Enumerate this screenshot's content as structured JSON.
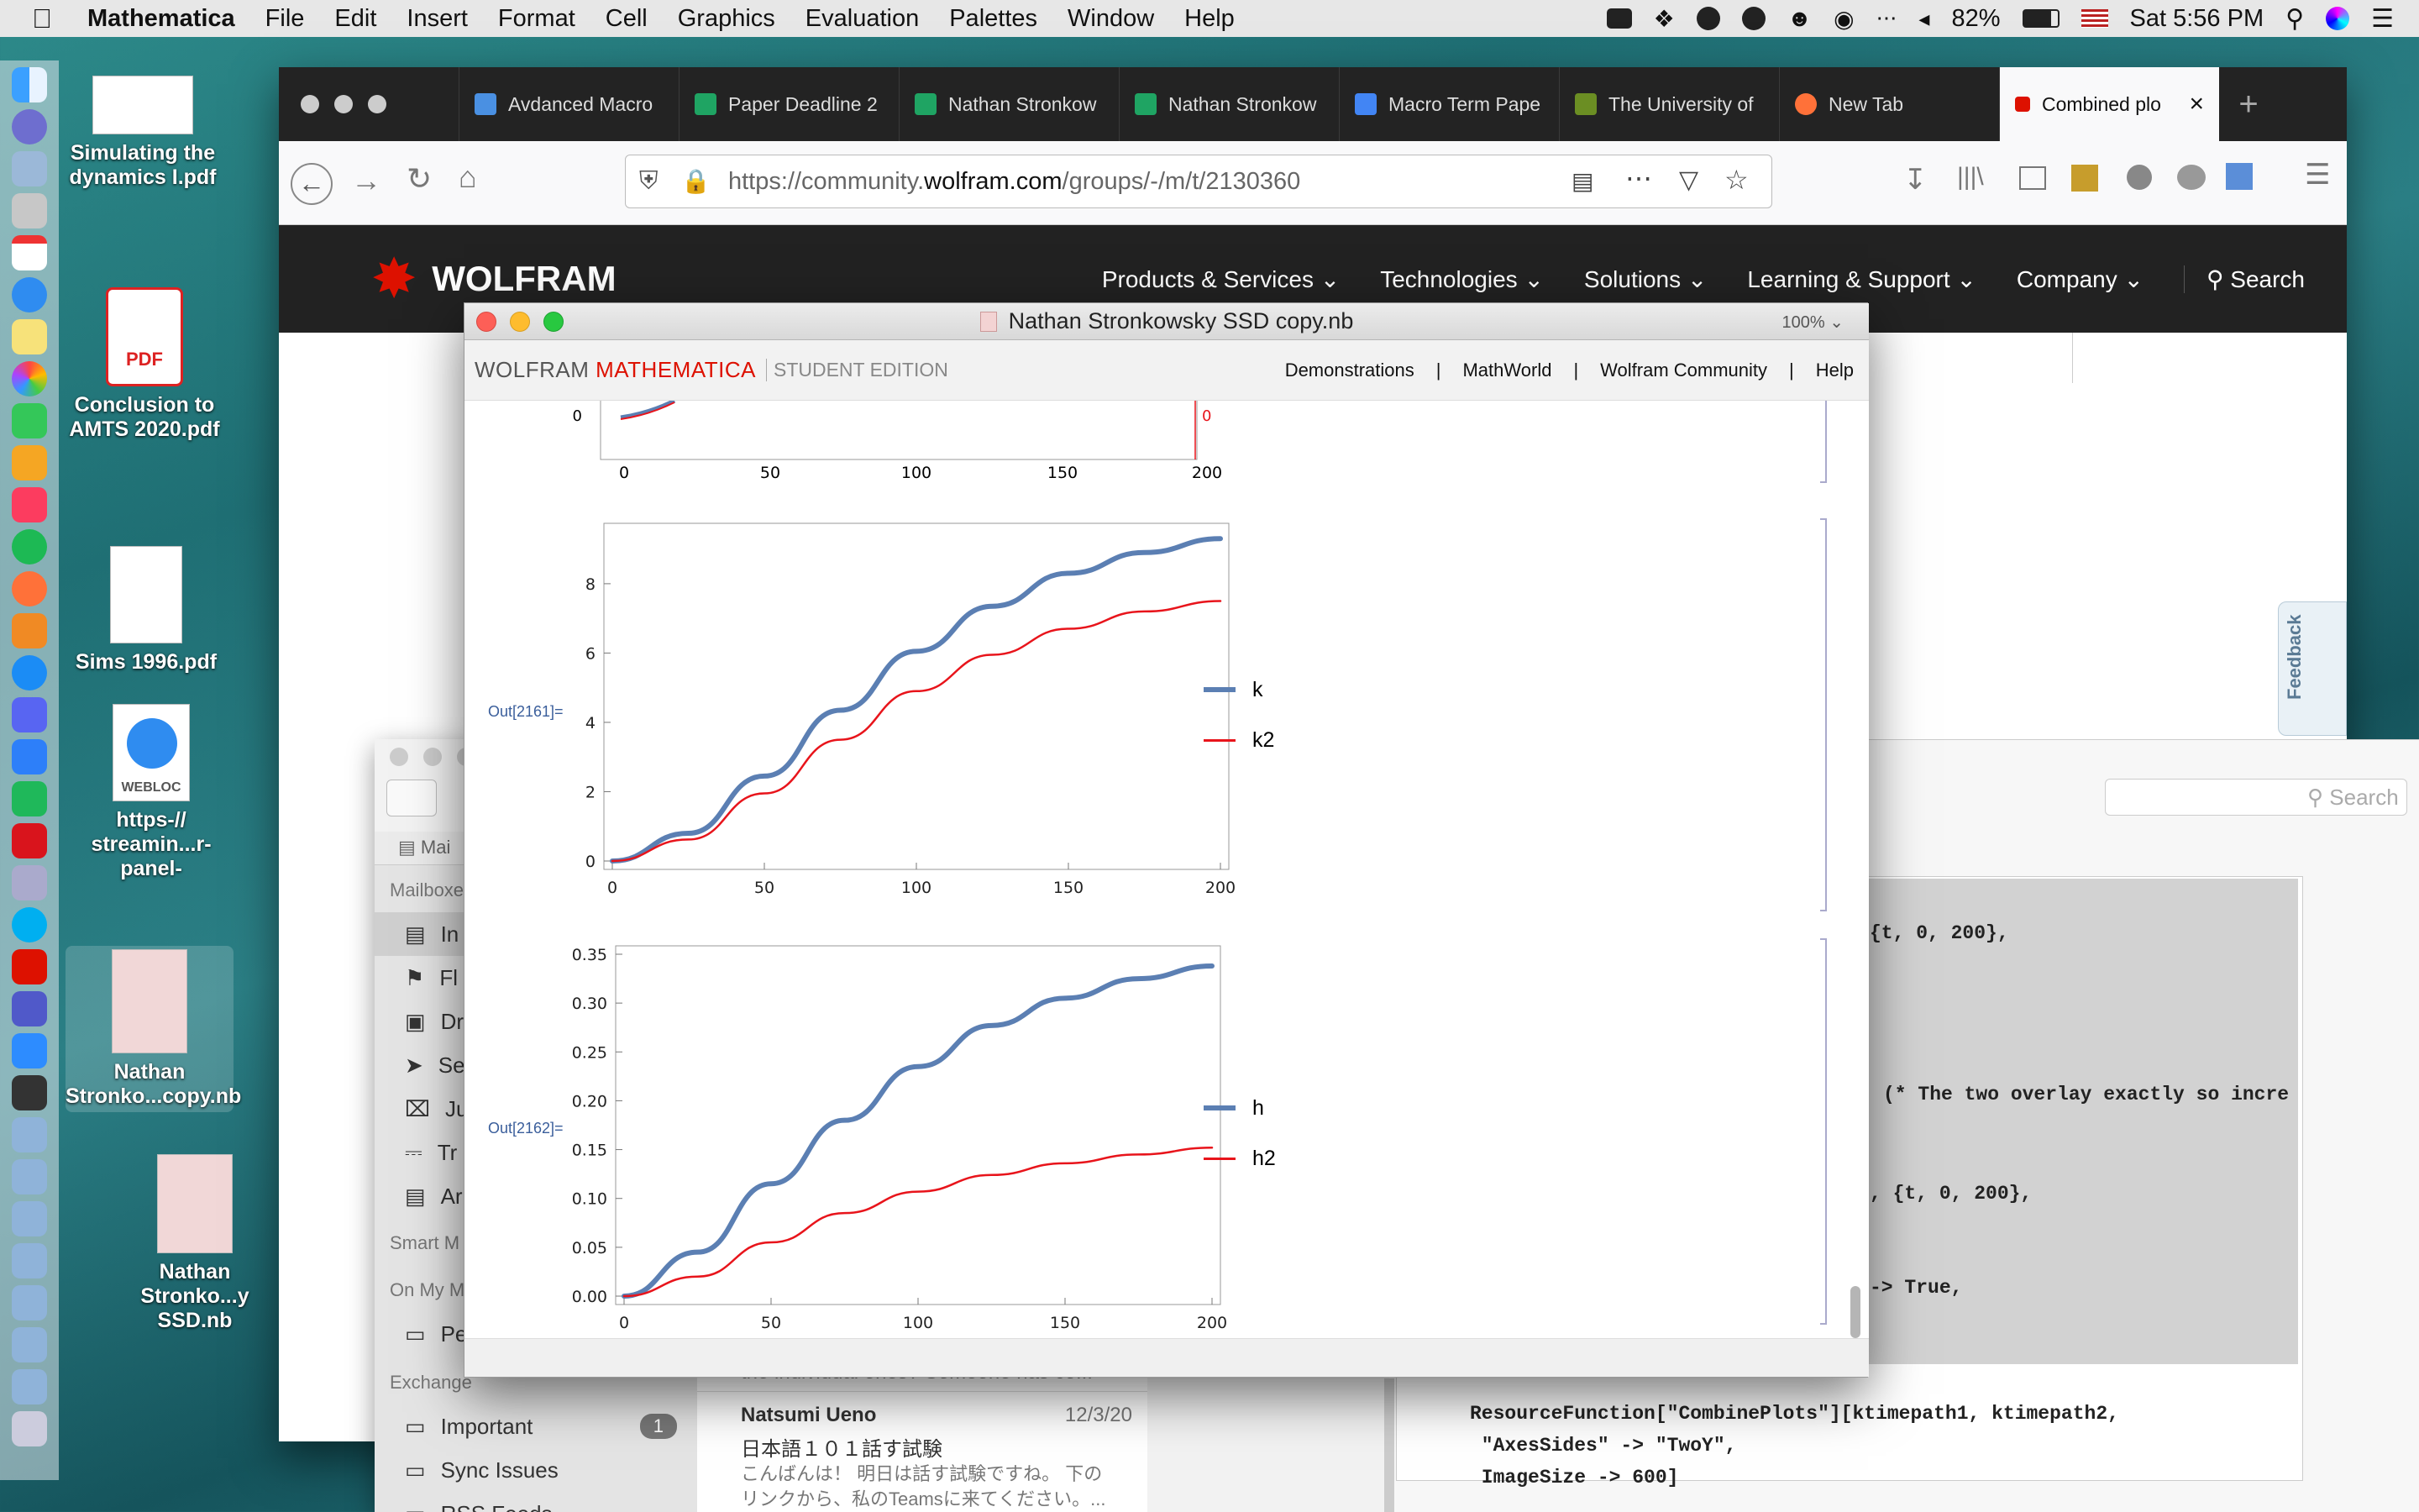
{
  "menubar": {
    "apple": "",
    "app": "Mathematica",
    "items": [
      "File",
      "Edit",
      "Insert",
      "Format",
      "Cell",
      "Graphics",
      "Evaluation",
      "Palettes",
      "Window",
      "Help"
    ],
    "battery": "82%",
    "clock": "Sat 5:56 PM"
  },
  "desktop": [
    {
      "label1": "Simulating the",
      "label2": "dynamics I.pdf"
    },
    {
      "label1": "Conclusion to",
      "label2": "AMTS 2020.pdf",
      "badge": "PDF"
    },
    {
      "label1": "Sims 1996.pdf",
      "label2": ""
    },
    {
      "label1": "https-//",
      "label2": "streamin...r-panel-",
      "badge": "WEBLOC"
    },
    {
      "label1": "Nathan",
      "label2": "Stronko...copy.nb"
    },
    {
      "label1": "Nathan",
      "label2": "Stronko...y SSD.nb"
    }
  ],
  "browser": {
    "tabs": [
      {
        "label": "Avdanced Macro",
        "color": "#4a90e2"
      },
      {
        "label": "Paper Deadline 2",
        "color": "#1fa463"
      },
      {
        "label": "Nathan Stronkow",
        "color": "#1fa463"
      },
      {
        "label": "Nathan Stronkow",
        "color": "#1fa463"
      },
      {
        "label": "Macro Term Pape",
        "color": "#4285f4"
      },
      {
        "label": "The University of",
        "color": "#6b8e23"
      },
      {
        "label": "New Tab",
        "color": "#ff7139"
      },
      {
        "label": "Combined plo",
        "color": "#dd1100"
      }
    ],
    "url_prefix": "https://community.",
    "url_domain": "wolfram.com",
    "url_path": "/groups/-/m/t/2130360",
    "site_logo": "WOLFRAM",
    "nav": [
      "Products & Services",
      "Technologies",
      "Solutions",
      "Learning & Support",
      "Company"
    ],
    "search": "Search",
    "feedback": "Feedback"
  },
  "mathematica": {
    "title": "Nathan Stronkowsky SSD copy.nb",
    "zoom": "100%",
    "brand_a": "WOLFRAM ",
    "brand_b": "MATHEMATICA",
    "brand_c": "STUDENT EDITION",
    "links": [
      "Demonstrations",
      "MathWorld",
      "Wolfram Community",
      "Help"
    ],
    "out1": "Out[2161]=",
    "out2": "Out[2162]="
  },
  "mail": {
    "search": "Search",
    "sidebar": [
      {
        "label": "Mailboxes",
        "type": "header"
      },
      {
        "label": "In",
        "type": "item"
      },
      {
        "label": "Fl",
        "type": "item"
      },
      {
        "label": "Dr",
        "type": "item"
      },
      {
        "label": "Se",
        "type": "item"
      },
      {
        "label": "Ju",
        "type": "item"
      },
      {
        "label": "Tr",
        "type": "item"
      },
      {
        "label": "Ar",
        "type": "item"
      },
      {
        "label": "Smart M",
        "type": "header"
      },
      {
        "label": "On My M",
        "type": "header"
      },
      {
        "label": "Pe",
        "type": "item"
      },
      {
        "label": "Exchange",
        "type": "header"
      },
      {
        "label": "Important",
        "type": "item",
        "badge": "1"
      },
      {
        "label": "Sync Issues",
        "type": "item"
      },
      {
        "label": "RSS Feeds",
        "type": "item"
      }
    ],
    "mailbox_tab": "Mai",
    "msg_snippet": "the individual ones? Someone has co...",
    "msg_from": "Natsumi Ueno",
    "msg_date": "12/3/20",
    "msg_subject": "日本語１０１話す試験",
    "msg_preview": "こんばんは！ 明日は話す試験ですね。 下の",
    "msg_preview2": "リンクから、私のTeamsに来てください。..."
  },
  "code": {
    "l1": "{t, 0, 200},",
    "l2": "(* The two overlay exactly so incre",
    "l3": ", {t, 0, 200},",
    "l4": "-> True,",
    "l5": "ResourceFunction[\"CombinePlots\"][ktimepath1, ktimepath2,",
    "l6": " \"AxesSides\" -> \"TwoY\",",
    "l7": " ImageSize -> 600]"
  },
  "chart_data": [
    {
      "type": "line",
      "x_ticks": [
        "0",
        "50",
        "100",
        "150",
        "200"
      ],
      "y_left_tick": "0",
      "y_right_tick": "0",
      "note": "partially visible plot (bottom only)"
    },
    {
      "type": "line",
      "xlim": [
        0,
        200
      ],
      "ylim": [
        0,
        9.5
      ],
      "x_ticks": [
        "0",
        "50",
        "100",
        "150",
        "200"
      ],
      "y_ticks": [
        "0",
        "2",
        "4",
        "6",
        "8"
      ],
      "x": [
        0,
        25,
        50,
        75,
        100,
        125,
        150,
        175,
        200
      ],
      "series": [
        {
          "name": "k",
          "color": "#5b7fb3",
          "values": [
            0,
            0.8,
            2.45,
            4.35,
            6.05,
            7.35,
            8.3,
            8.9,
            9.3
          ]
        },
        {
          "name": "k2",
          "color": "#e8141b",
          "values": [
            0,
            0.62,
            1.95,
            3.5,
            4.9,
            5.95,
            6.7,
            7.2,
            7.5
          ]
        }
      ]
    },
    {
      "type": "line",
      "xlim": [
        0,
        200
      ],
      "ylim": [
        0,
        0.35
      ],
      "x_ticks": [
        "0",
        "50",
        "100",
        "150",
        "200"
      ],
      "y_ticks": [
        "0.00",
        "0.05",
        "0.10",
        "0.15",
        "0.20",
        "0.25",
        "0.30",
        "0.35"
      ],
      "x": [
        0,
        25,
        50,
        75,
        100,
        125,
        150,
        175,
        200
      ],
      "series": [
        {
          "name": "h",
          "color": "#5b7fb3",
          "values": [
            0,
            0.045,
            0.115,
            0.18,
            0.235,
            0.277,
            0.305,
            0.325,
            0.338
          ]
        },
        {
          "name": "h2",
          "color": "#e8141b",
          "values": [
            0,
            0.02,
            0.055,
            0.085,
            0.107,
            0.124,
            0.136,
            0.145,
            0.152
          ]
        }
      ]
    }
  ]
}
